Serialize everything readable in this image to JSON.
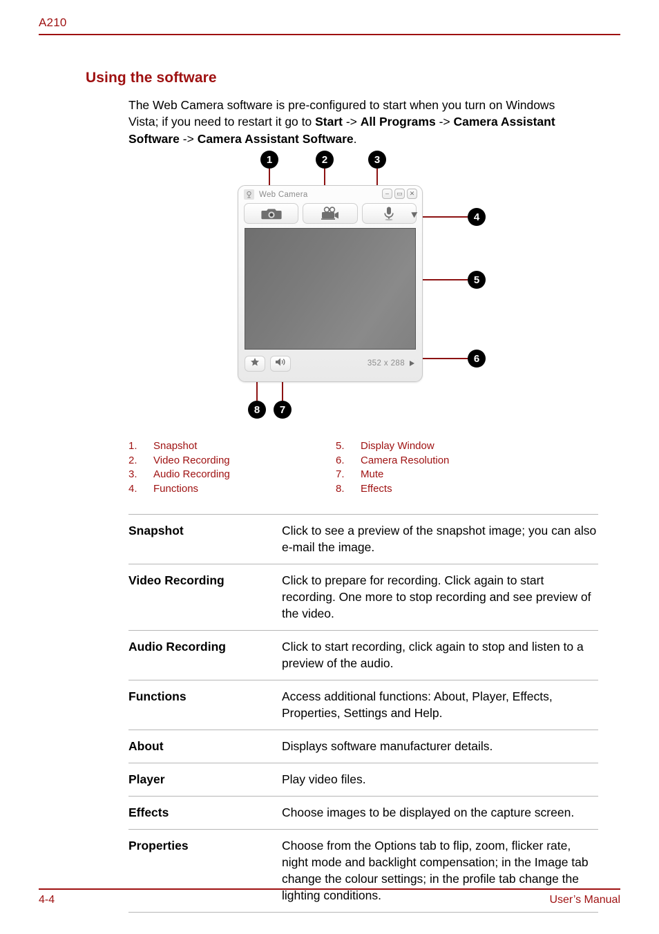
{
  "header": {
    "model": "A210"
  },
  "section": {
    "heading": "Using the software",
    "intro": {
      "part1": "The Web Camera software is pre-configured to start when you turn on Windows Vista; if you need to restart it go to ",
      "bold1": "Start",
      "sep1": " -> ",
      "bold2": "All Programs",
      "sep2": " -> ",
      "bold3": "Camera Assistant Software",
      "sep3": " -> ",
      "bold4": "Camera Assistant Software",
      "end": "."
    }
  },
  "figure": {
    "callouts": [
      {
        "number": "1",
        "target": "snapshot-button"
      },
      {
        "number": "2",
        "target": "video-recording-button"
      },
      {
        "number": "3",
        "target": "audio-recording-button"
      },
      {
        "number": "4",
        "target": "functions-arrow"
      },
      {
        "number": "5",
        "target": "display-window"
      },
      {
        "number": "6",
        "target": "camera-resolution"
      },
      {
        "number": "7",
        "target": "mute-button"
      },
      {
        "number": "8",
        "target": "effects-button"
      }
    ],
    "window": {
      "title": "Web Camera",
      "title_icon": "webcam-icon",
      "window_buttons": [
        {
          "label": "–",
          "name": "minimize-button"
        },
        {
          "label": "▭",
          "name": "maximize-button"
        },
        {
          "label": "✕",
          "name": "close-button"
        }
      ],
      "toolbar": [
        {
          "name": "snapshot-button",
          "icon": "camera-icon"
        },
        {
          "name": "video-recording-button",
          "icon": "video-camera-icon"
        },
        {
          "name": "audio-recording-button",
          "icon": "microphone-icon"
        }
      ],
      "bottom": [
        {
          "name": "effects-button",
          "icon": "star-icon"
        },
        {
          "name": "mute-button",
          "icon": "speaker-icon"
        }
      ],
      "resolution": "352 x 288"
    }
  },
  "legend": {
    "left": [
      {
        "number": "1.",
        "label": "Snapshot"
      },
      {
        "number": "2.",
        "label": "Video Recording"
      },
      {
        "number": "3.",
        "label": "Audio Recording"
      },
      {
        "number": "4.",
        "label": "Functions"
      }
    ],
    "right": [
      {
        "number": "5.",
        "label": "Display Window"
      },
      {
        "number": "6.",
        "label": "Camera Resolution"
      },
      {
        "number": "7.",
        "label": "Mute"
      },
      {
        "number": "8.",
        "label": "Effects"
      }
    ]
  },
  "definitions": [
    {
      "term": "Snapshot",
      "desc": "Click to see a preview of the snapshot image; you can also e-mail the image."
    },
    {
      "term": "Video Recording",
      "desc": "Click to prepare for recording. Click again to start recording. One more to stop recording and see preview of the video."
    },
    {
      "term": "Audio Recording",
      "desc": "Click to start recording, click again to stop and listen to a preview of the audio."
    },
    {
      "term": "Functions",
      "desc": "Access additional functions: About, Player, Effects, Properties, Settings and Help."
    },
    {
      "term": "About",
      "desc": "Displays software manufacturer details."
    },
    {
      "term": "Player",
      "desc": "Play video files."
    },
    {
      "term": "Effects",
      "desc": "Choose images to be displayed on the capture screen."
    },
    {
      "term": "Properties",
      "desc": "Choose from the Options tab to flip, zoom, flicker rate, night mode and backlight compensation; in the Image tab change the colour settings; in the profile tab change the lighting conditions."
    }
  ],
  "footer": {
    "page_number": "4-4",
    "manual_label": "User’s Manual"
  },
  "colors": {
    "accent_red": "#9e1010",
    "leader_red": "#8c1212",
    "callout_black": "#000000",
    "rule_gray": "#b5b5b5",
    "display_gray": "#7c7c7c"
  }
}
